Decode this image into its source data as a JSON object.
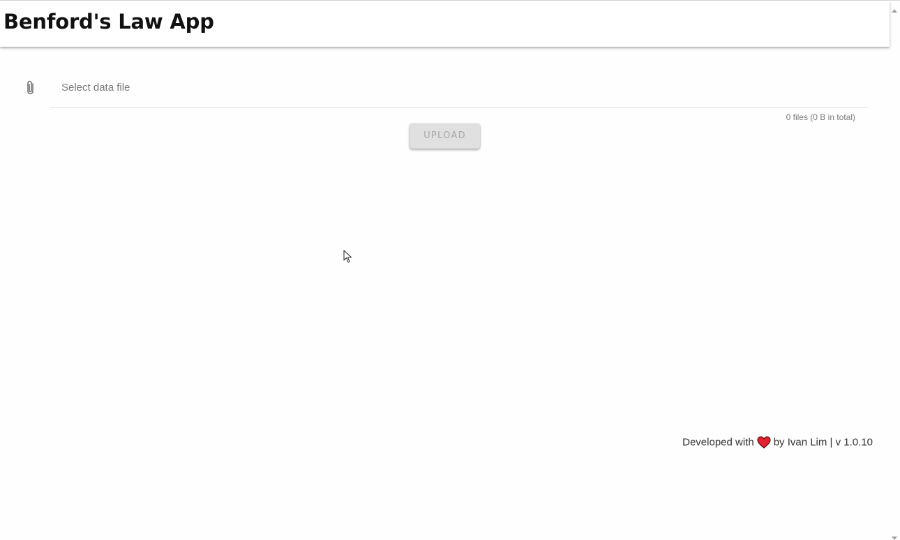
{
  "app": {
    "title": "Benford's Law App"
  },
  "file_input": {
    "placeholder": "Select data file",
    "icon": "paperclip-icon",
    "summary": "0 files (0 B in total)"
  },
  "upload": {
    "label": "UPLOAD",
    "disabled": true
  },
  "footer": {
    "prefix": "Developed with",
    "heart_icon": "heart-icon",
    "suffix": "by Ivan Lim | v 1.0.10"
  },
  "colors": {
    "heart": "#e5202f",
    "button_bg": "#e0e0e0",
    "button_text": "#a8a8a8"
  }
}
